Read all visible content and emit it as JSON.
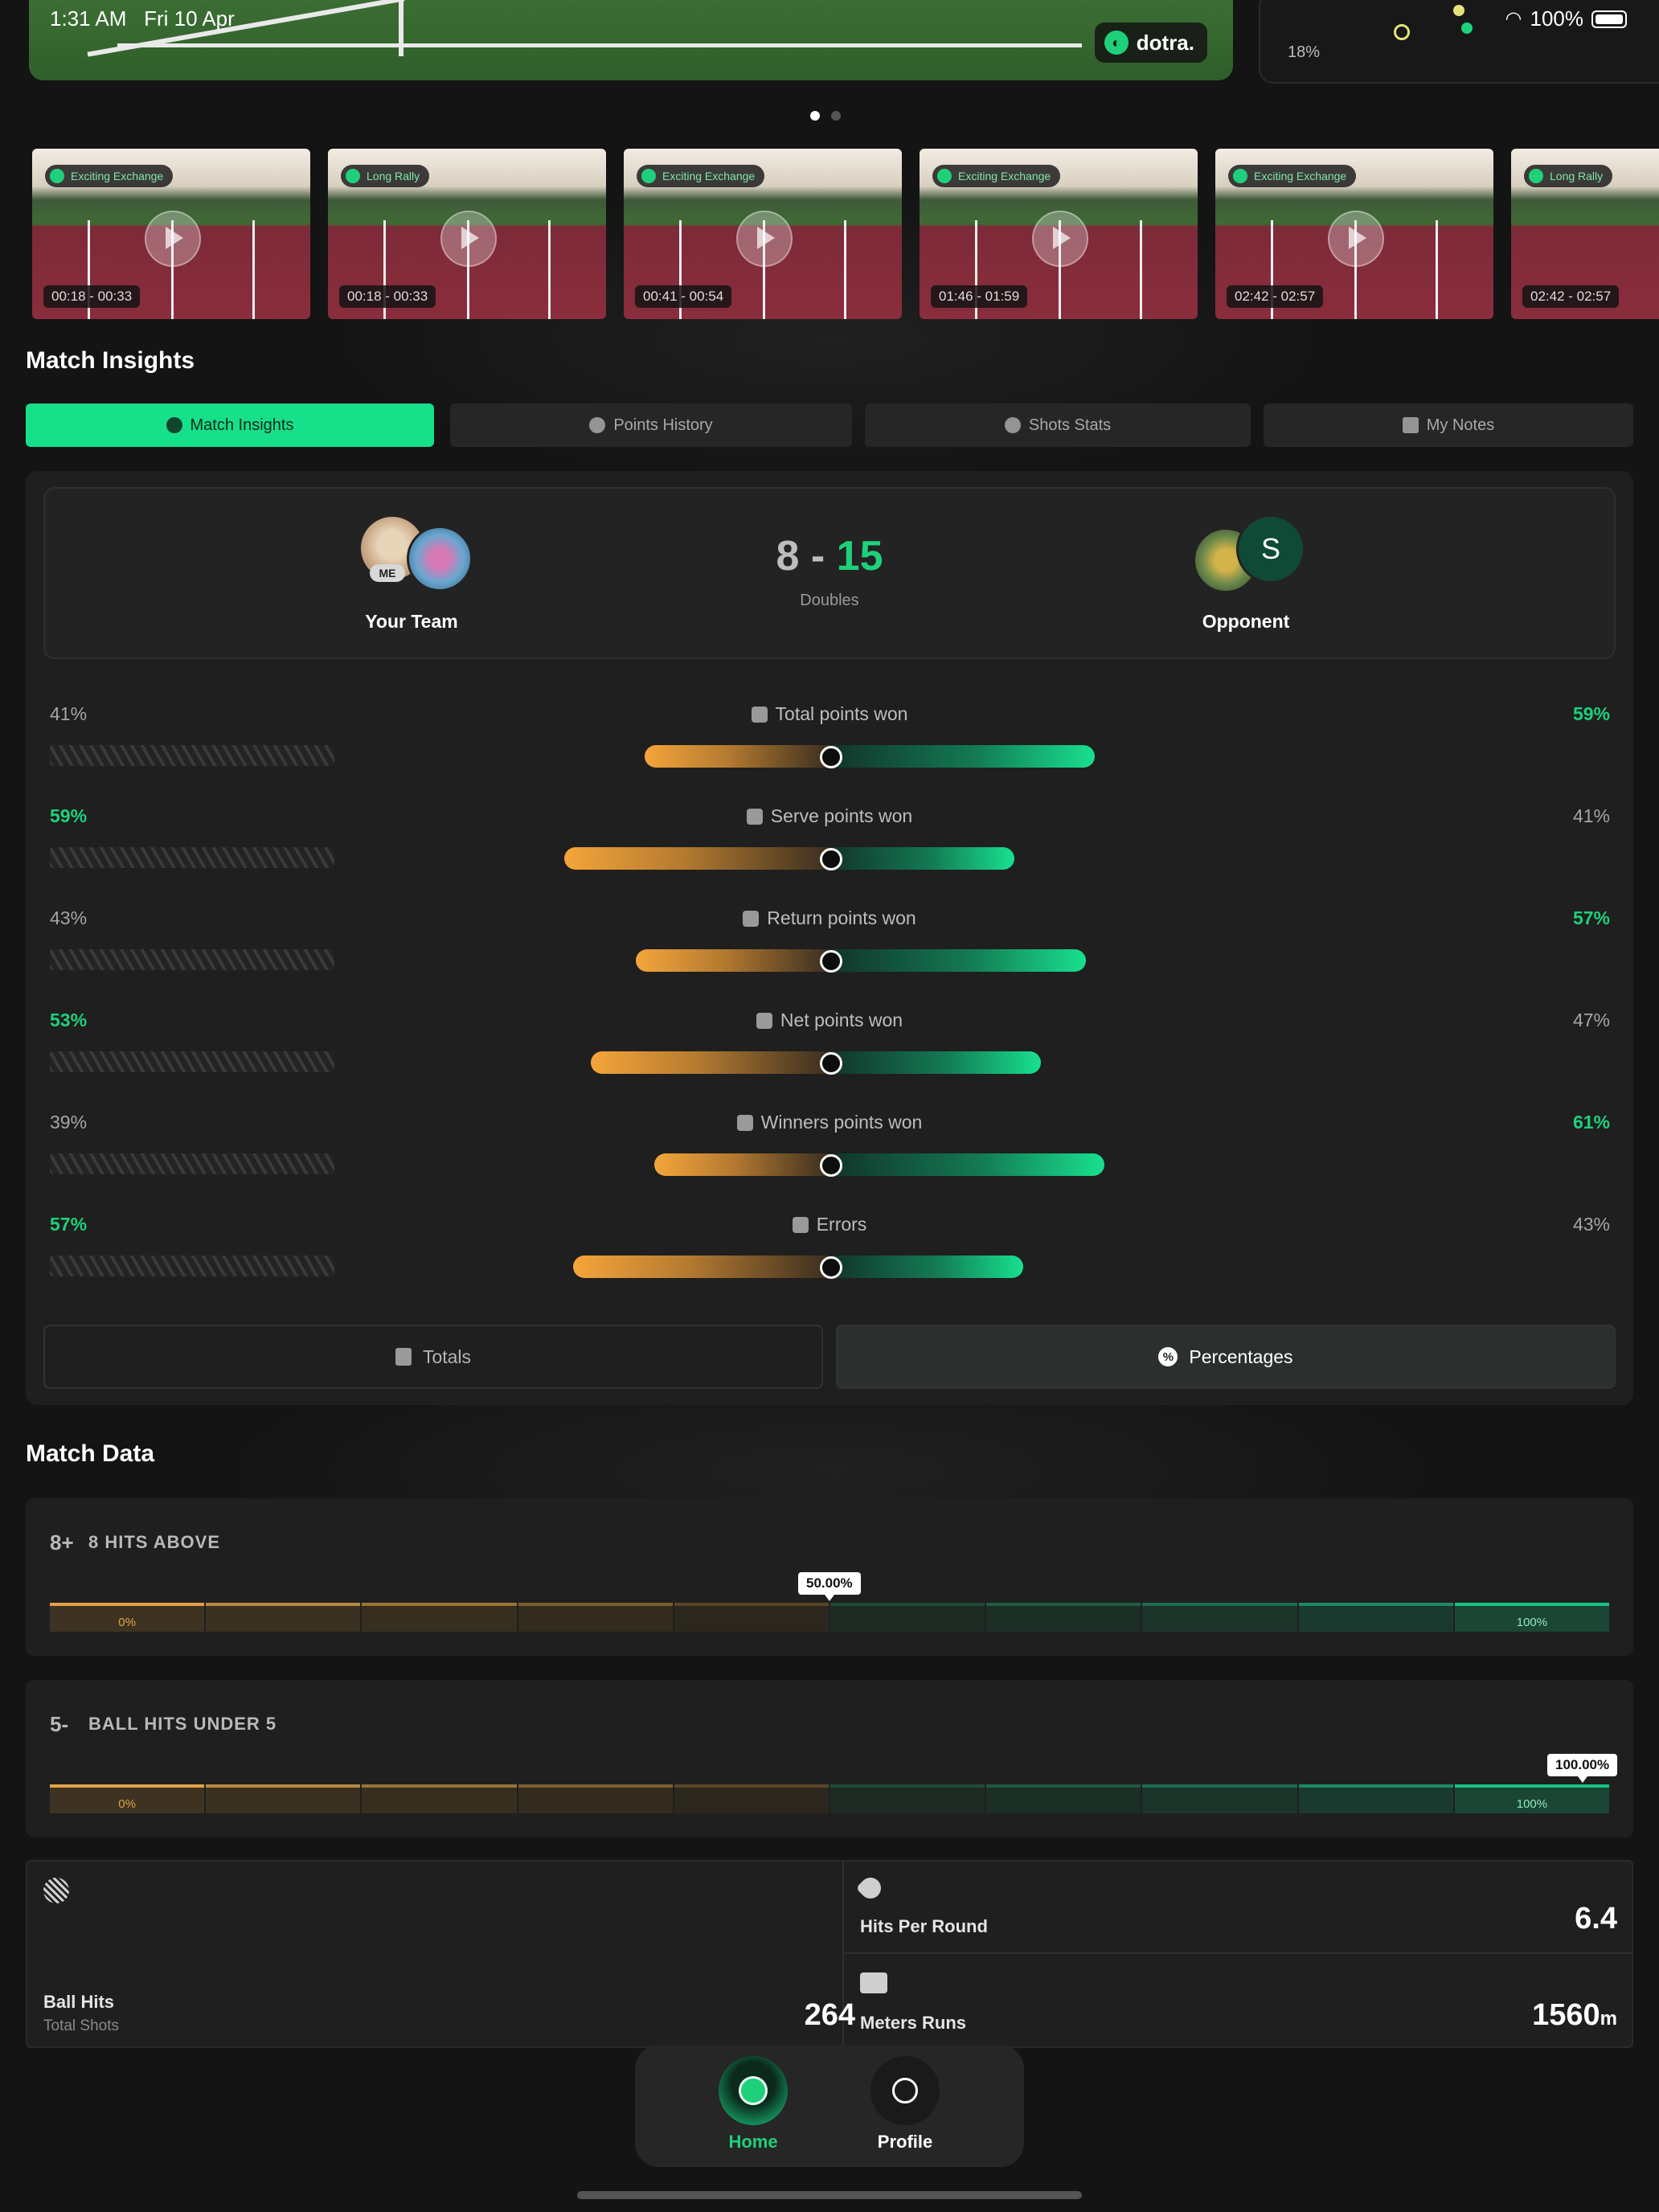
{
  "status_bar": {
    "time": "1:31 AM",
    "date": "Fri 10 Apr",
    "battery": "100%"
  },
  "hero": {
    "brand": "dotra.",
    "side_percent": "18%"
  },
  "clips": [
    {
      "tag": "Exciting Exchange",
      "time": "00:18 - 00:33"
    },
    {
      "tag": "Long Rally",
      "time": "00:18 - 00:33"
    },
    {
      "tag": "Exciting Exchange",
      "time": "00:41 - 00:54"
    },
    {
      "tag": "Exciting Exchange",
      "time": "01:46 - 01:59"
    },
    {
      "tag": "Exciting Exchange",
      "time": "02:42 - 02:57"
    },
    {
      "tag": "Long Rally",
      "time": "02:42 - 02:57"
    }
  ],
  "insights": {
    "heading": "Match Insights",
    "tabs": [
      "Match Insights",
      "Points History",
      "Shots Stats",
      "My Notes"
    ],
    "your_team": "Your Team",
    "me_badge": "ME",
    "opponent": "Opponent",
    "opponent_initial": "S",
    "score_team": "8",
    "score_sep": "-",
    "score_opp": "15",
    "mode": "Doubles",
    "stats": [
      {
        "label": "Total points won",
        "left": "41%",
        "right": "59%",
        "left_val": 41,
        "right_val": 59
      },
      {
        "label": "Serve points won",
        "left": "59%",
        "right": "41%",
        "left_val": 59,
        "right_val": 41
      },
      {
        "label": "Return points won",
        "left": "43%",
        "right": "57%",
        "left_val": 43,
        "right_val": 57
      },
      {
        "label": "Net points won",
        "left": "53%",
        "right": "47%",
        "left_val": 53,
        "right_val": 47
      },
      {
        "label": "Winners points won",
        "left": "39%",
        "right": "61%",
        "left_val": 39,
        "right_val": 61
      },
      {
        "label": "Errors",
        "left": "57%",
        "right": "43%",
        "left_val": 57,
        "right_val": 43
      }
    ],
    "btn_totals": "Totals",
    "btn_percentages": "Percentages"
  },
  "match_data": {
    "heading": "Match Data",
    "rows": [
      {
        "prefix": "8+",
        "title": "8 HITS ABOVE",
        "value": 0.5,
        "tag": "50.00%",
        "low": "0%",
        "high": "100%"
      },
      {
        "prefix": "5-",
        "title": "BALL HITS UNDER 5",
        "value": 1.0,
        "tag": "100.00%",
        "low": "0%",
        "high": "100%"
      }
    ]
  },
  "totals": {
    "ball_hits_label": "Ball Hits",
    "ball_hits_sub": "Total Shots",
    "ball_hits_value": "264",
    "hits_per_round_label": "Hits Per Round",
    "hits_per_round_value": "6.4",
    "meters_label": "Meters Runs",
    "meters_value": "1560",
    "meters_unit": "m"
  },
  "nav": {
    "home": "Home",
    "profile": "Profile"
  },
  "colors": {
    "accent": "#1fd07a",
    "team": "#f5a53a"
  }
}
